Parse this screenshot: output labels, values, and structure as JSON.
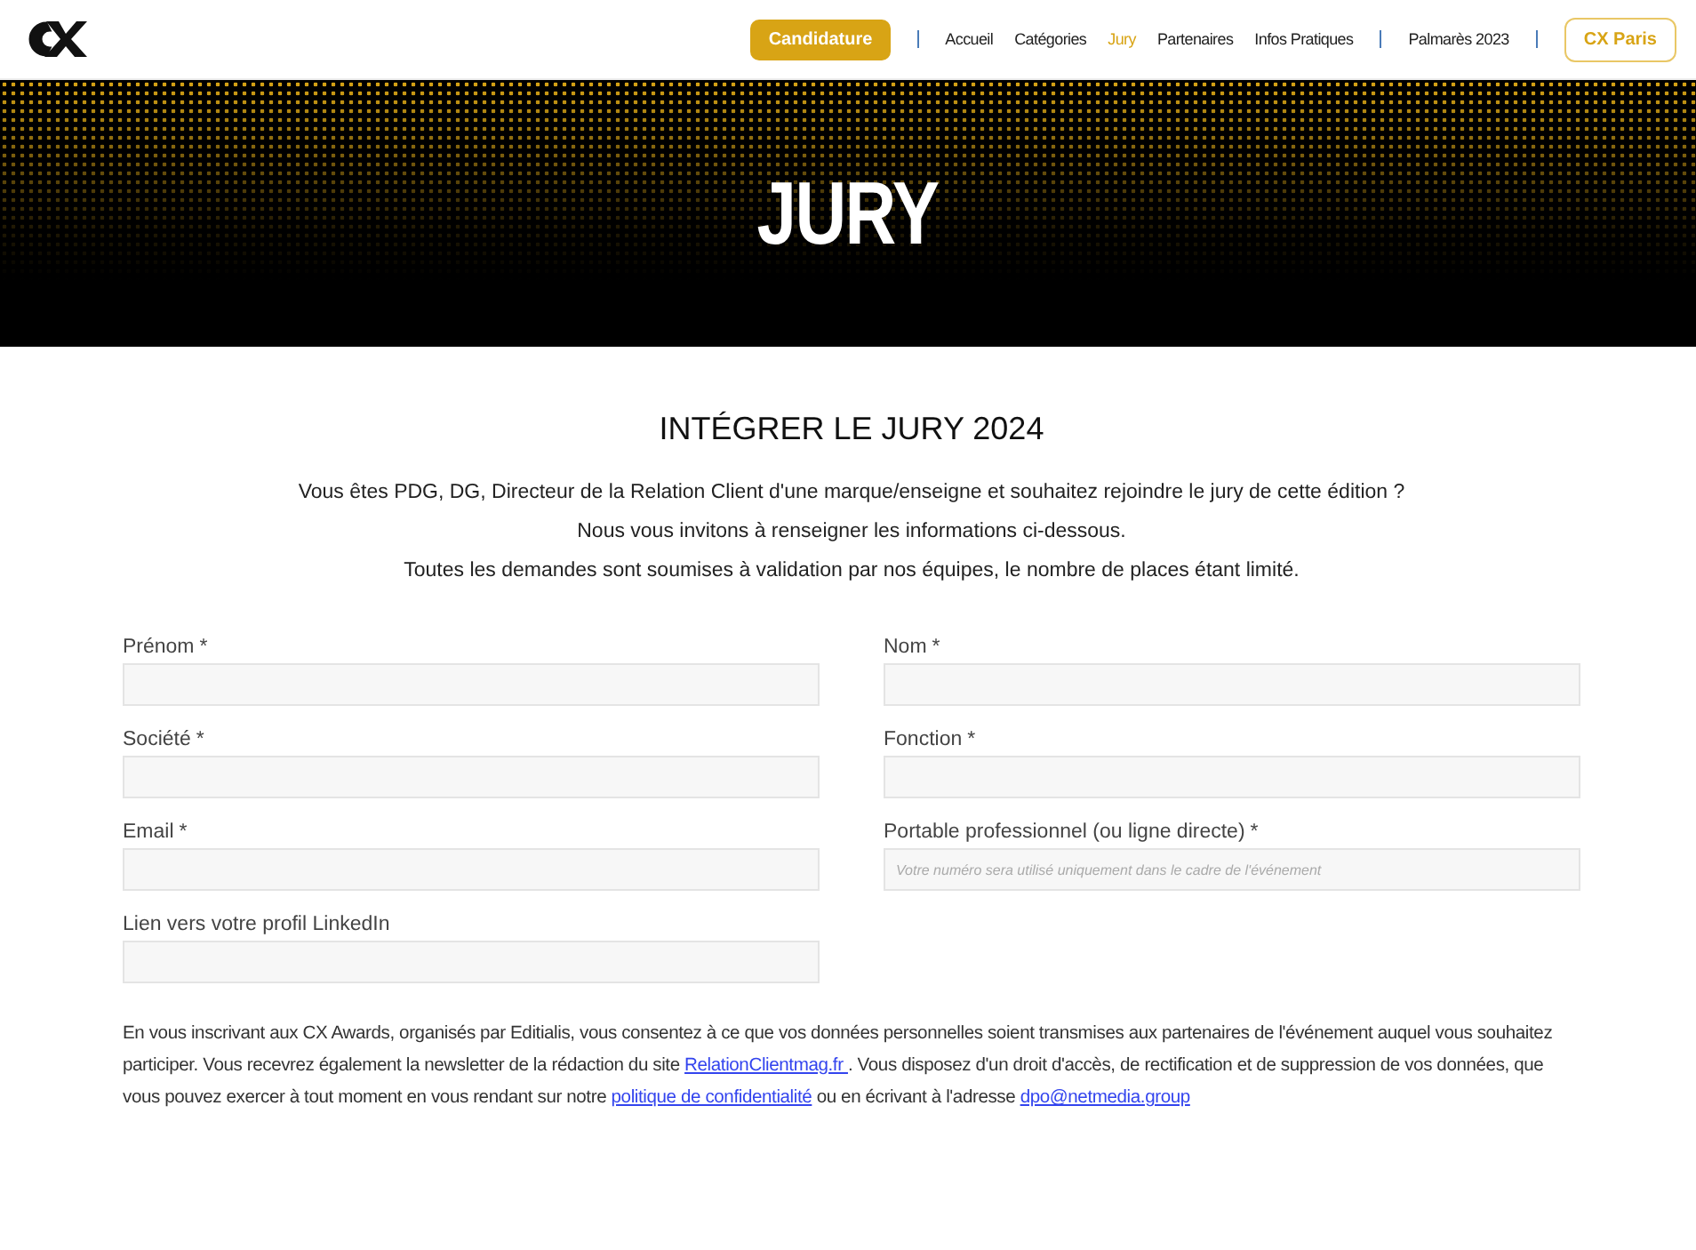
{
  "header": {
    "nav": [
      {
        "kind": "cta",
        "label": "Candidature"
      },
      {
        "kind": "separator"
      },
      {
        "kind": "link",
        "label": "Accueil",
        "selected": false
      },
      {
        "kind": "link",
        "label": "Catégories",
        "selected": false
      },
      {
        "kind": "link",
        "label": "Jury",
        "selected": true
      },
      {
        "kind": "link",
        "label": "Partenaires",
        "selected": false
      },
      {
        "kind": "link",
        "label": "Infos Pratiques",
        "selected": false
      },
      {
        "kind": "separator"
      },
      {
        "kind": "link",
        "label": "Palmarès 2023",
        "selected": false
      },
      {
        "kind": "separator"
      },
      {
        "kind": "outline",
        "label": "CX Paris"
      }
    ]
  },
  "hero": {
    "title": "JURY"
  },
  "section": {
    "title": "INTÉGRER LE JURY 2024",
    "intro": [
      "Vous êtes PDG, DG, Directeur de la Relation Client d'une marque/enseigne et souhaitez rejoindre le jury de cette édition ?",
      "Nous vous invitons à renseigner les informations ci-dessous.",
      "Toutes les demandes sont soumises à validation par nos équipes, le nombre de places étant limité."
    ]
  },
  "form": {
    "fields": [
      {
        "label": "Prénom",
        "required": true
      },
      {
        "label": "Nom",
        "required": true
      },
      {
        "label": "Société",
        "required": true
      },
      {
        "label": "Fonction",
        "required": true
      },
      {
        "label": "Email",
        "required": true
      },
      {
        "label": "Portable professionnel (ou ligne directe)",
        "required": true,
        "placeholder": "Votre numéro sera utilisé uniquement dans le cadre de l'événement"
      },
      {
        "label": "Lien vers votre profil LinkedIn",
        "required": false
      }
    ],
    "required_mark": "*",
    "legal": [
      {
        "kind": "text",
        "text": "En vous inscrivant aux CX Awards, organisés par Editialis, vous consentez à ce que vos données personnelles soient transmises aux partenaires de l'événement auquel vous souhaitez participer. Vous recevrez également la newsletter de la rédaction du site "
      },
      {
        "kind": "link",
        "text": "RelationClientmag.fr "
      },
      {
        "kind": "text",
        "text": ". Vous disposez d'un droit d'accès, de rectification et de suppression de vos données, que vous pouvez exercer à tout moment en vous rendant sur notre "
      },
      {
        "kind": "link",
        "text": "politique de confidentialité"
      },
      {
        "kind": "text",
        "text": " ou en écrivant à l'adresse "
      },
      {
        "kind": "link",
        "text": "dpo@netmedia.group"
      }
    ]
  }
}
